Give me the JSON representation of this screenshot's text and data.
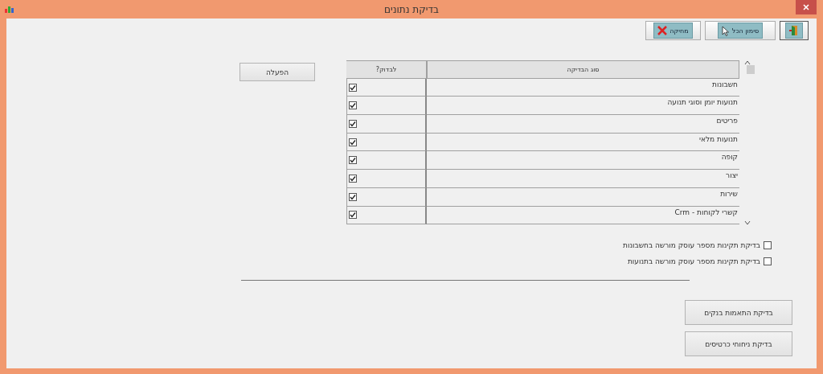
{
  "window": {
    "title": "בדיקת נתונים"
  },
  "toolbar": [
    {
      "kind": "exit"
    },
    {
      "kind": "select_all",
      "label": "סימון הכל"
    },
    {
      "kind": "delete",
      "label": "מחיקה"
    }
  ],
  "activate_button": "הפעלה",
  "table": {
    "columns": [
      "סוג הבדיקה",
      "לבדוק?"
    ],
    "rows": [
      {
        "type": "חשבונות",
        "checked": true
      },
      {
        "type": "תנועות יומן וסוגי תנועה",
        "checked": true
      },
      {
        "type": "פריטים",
        "checked": true
      },
      {
        "type": "תנועות מלאי",
        "checked": true
      },
      {
        "type": "קופה",
        "checked": true
      },
      {
        "type": "יצור",
        "checked": true
      },
      {
        "type": "שירות",
        "checked": true
      },
      {
        "type": "קשרי לקוחות - Crm",
        "checked": true
      }
    ]
  },
  "options": [
    {
      "label": "בדיקת תקינות מספר עוסק מורשה בחשבונות",
      "checked": false
    },
    {
      "label": "בדיקת תקינות מספר עוסק מורשה בתנועות",
      "checked": false
    }
  ],
  "action_buttons": [
    "בדיקת התאמות בנקים",
    "בדיקת ניחוחי כרטיסים"
  ]
}
